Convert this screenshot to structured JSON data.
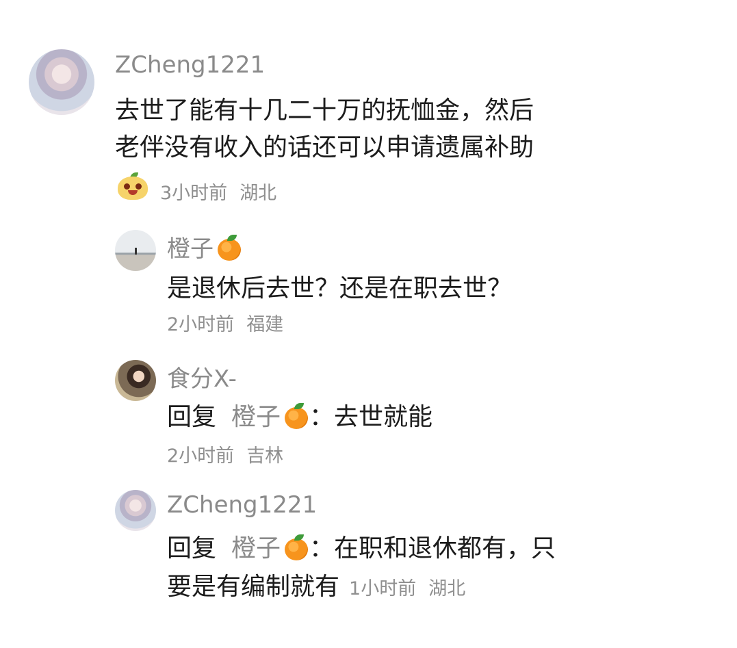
{
  "comments": [
    {
      "username": "ZCheng1221",
      "lines": [
        "去世了能有十几二十万的抚恤金，然后",
        "老伴没有收入的话还可以申请遗属补助"
      ],
      "time": "3小时前",
      "location": "湖北",
      "sticker_icon": "mascot-sticker-icon"
    },
    {
      "username": "橙子",
      "username_emoji": "tangerine-icon",
      "text": "是退休后去世？还是在职去世？",
      "time": "2小时前",
      "location": "福建"
    },
    {
      "username": "食分X-",
      "reply_label": "回复",
      "reply_to": "橙子",
      "reply_to_emoji": "tangerine-icon",
      "text": "：去世就能",
      "time": "2小时前",
      "location": "吉林"
    },
    {
      "username": "ZCheng1221",
      "reply_label": "回复",
      "reply_to": "橙子",
      "reply_to_emoji": "tangerine-icon",
      "line1": "：在职和退休都有，只",
      "line2": "要是有编制就有",
      "time": "1小时前",
      "location": "湖北"
    }
  ],
  "colors": {
    "background": "#ffffff",
    "username": "#8a8a8a",
    "body_text": "#1c1c1c",
    "meta_text": "#8f8f8f",
    "emoji_orange": "#f7941d"
  }
}
